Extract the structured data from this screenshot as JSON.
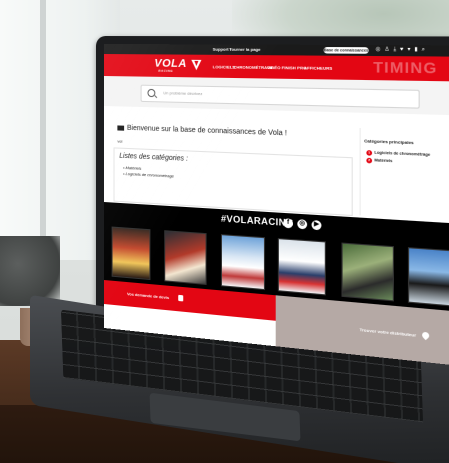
{
  "topbar": {
    "links": [
      "Support",
      "Tourner la page"
    ],
    "knowledge_base_button": "Base de connaissances",
    "icons": [
      "globe-icon",
      "user-icon",
      "download-icon",
      "heart-icon",
      "cart-icon",
      "flag-icon",
      "search-icon"
    ]
  },
  "navbar": {
    "brand": "VOLA",
    "brand_sub": "RACING",
    "items": [
      "LOGICIELS",
      "CHRONOMÉTRAGE",
      "VIDÉO FINISH PRO",
      "AFFICHEURS"
    ],
    "section_watermark": "TIMING"
  },
  "search": {
    "placeholder": "Un problème décrivez"
  },
  "content": {
    "welcome": "Bienvenue sur la base de connaissances de Vola !",
    "breadcrumb": "vol",
    "lists_title": "Listes des catégories :",
    "list_items": [
      "• Matériels",
      "• Logiciels de chronométrage"
    ]
  },
  "sidebar": {
    "title": "Catégories principales",
    "items": [
      {
        "number": "1",
        "label": "Logiciels de chronométrage"
      },
      {
        "number": "2",
        "label": "Matériels"
      }
    ]
  },
  "social": {
    "hashtag": "#VOLARACING",
    "icons": [
      "facebook-icon",
      "instagram-icon",
      "youtube-icon"
    ]
  },
  "footer": {
    "left_label": "Vos demande de devis",
    "right_label": "Trouver votre distributeur"
  },
  "colors": {
    "brand_red": "#e30613",
    "topbar_black": "#1a1a1a",
    "footer_taupe": "#b5a9a5"
  }
}
